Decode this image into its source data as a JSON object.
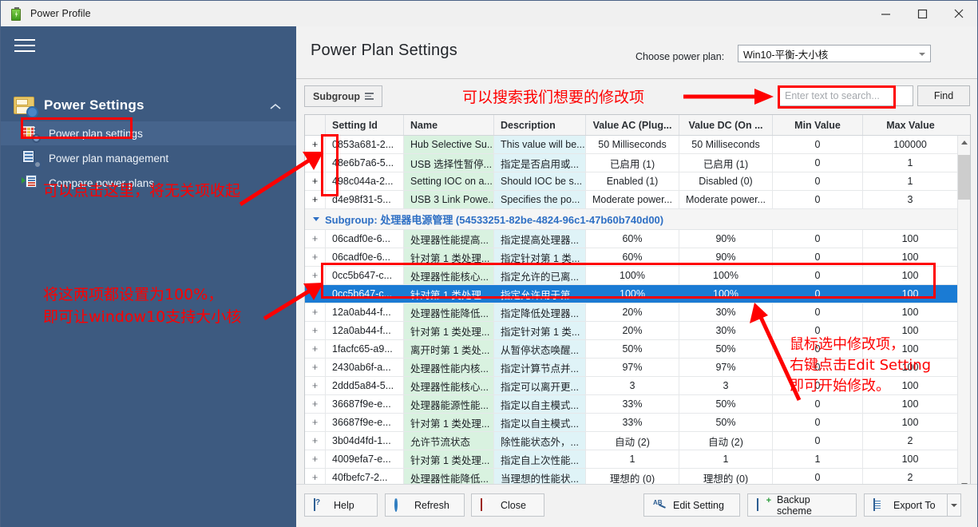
{
  "window": {
    "title": "Power Profile",
    "icon": "battery-icon",
    "minimize": "minimize-icon",
    "maximize": "maximize-icon",
    "close": "close-icon"
  },
  "sidebar": {
    "menu_icon": "hamburger-icon",
    "group": {
      "label": "Power Settings",
      "icon": "power-settings-icon",
      "chevron": "chevron-up-icon"
    },
    "items": [
      {
        "label": "Power plan settings",
        "icon": "power-plan-settings-icon",
        "active": true
      },
      {
        "label": "Power plan management",
        "icon": "power-plan-management-icon",
        "active": false
      },
      {
        "label": "Compare power plans",
        "icon": "compare-power-plans-icon",
        "active": false
      }
    ]
  },
  "header": {
    "title": "Power Plan Settings",
    "choose_label": "Choose power plan:",
    "plan_selected": "Win10-平衡-大小核"
  },
  "toolbar": {
    "subgroup_label": "Subgroup",
    "search_placeholder": "Enter text to search...",
    "search_value": "",
    "find_label": "Find"
  },
  "grid": {
    "columns": [
      "Setting Id",
      "Name",
      "Description",
      "Value AC (Plug...",
      "Value DC (On ...",
      "Min Value",
      "Max Value"
    ],
    "subgroup_header": "Subgroup: 处理器电源管理 (54533251-82be-4824-96c1-47b60b740d00)",
    "rows_top": [
      {
        "expand": "+",
        "id": "0853a681-2...",
        "name": "Hub Selective Su...",
        "desc": "This value will be...",
        "ac": "50 Milliseconds",
        "dc": "50 Milliseconds",
        "min": "0",
        "max": "100000",
        "selected": false
      },
      {
        "expand": "+",
        "id": "48e6b7a6-5...",
        "name": "USB 选择性暂停...",
        "desc": "指定是否启用或...",
        "ac": "已启用 (1)",
        "dc": "已启用 (1)",
        "min": "0",
        "max": "1",
        "selected": false
      },
      {
        "expand": "+",
        "id": "498c044a-2...",
        "name": "Setting IOC on a...",
        "desc": "Should IOC be s...",
        "ac": "Enabled (1)",
        "dc": "Disabled (0)",
        "min": "0",
        "max": "1",
        "selected": false
      },
      {
        "expand": "+",
        "id": "d4e98f31-5...",
        "name": "USB 3 Link Powe...",
        "desc": "Specifies the po...",
        "ac": "Moderate power...",
        "dc": "Moderate power...",
        "min": "0",
        "max": "3",
        "selected": false
      }
    ],
    "rows_bottom": [
      {
        "expand": "+",
        "id": "06cadf0e-6...",
        "name": "处理器性能提高...",
        "desc": "指定提高处理器...",
        "ac": "60%",
        "dc": "90%",
        "min": "0",
        "max": "100",
        "selected": false
      },
      {
        "expand": "+",
        "id": "06cadf0e-6...",
        "name": "针对第 1 类处理...",
        "desc": "指定针对第 1 类...",
        "ac": "60%",
        "dc": "90%",
        "min": "0",
        "max": "100",
        "selected": false
      },
      {
        "expand": "+",
        "id": "0cc5b647-c...",
        "name": "处理器性能核心...",
        "desc": "指定允许的已离...",
        "ac": "100%",
        "dc": "100%",
        "min": "0",
        "max": "100",
        "selected": false
      },
      {
        "expand": "+",
        "id": "0cc5b647-c...",
        "name": "针对第 1 类处理...",
        "desc": "指定允许用于第 ...",
        "ac": "100%",
        "dc": "100%",
        "min": "0",
        "max": "100",
        "selected": true
      },
      {
        "expand": "+",
        "id": "12a0ab44-f...",
        "name": "处理器性能降低...",
        "desc": "指定降低处理器...",
        "ac": "20%",
        "dc": "30%",
        "min": "0",
        "max": "100",
        "selected": false
      },
      {
        "expand": "+",
        "id": "12a0ab44-f...",
        "name": "针对第 1 类处理...",
        "desc": "指定针对第 1 类...",
        "ac": "20%",
        "dc": "30%",
        "min": "0",
        "max": "100",
        "selected": false
      },
      {
        "expand": "+",
        "id": "1facfc65-a9...",
        "name": "离开时第 1 类处...",
        "desc": "从暂停状态唤醒...",
        "ac": "50%",
        "dc": "50%",
        "min": "0",
        "max": "100",
        "selected": false
      },
      {
        "expand": "+",
        "id": "2430ab6f-a...",
        "name": "处理器性能内核...",
        "desc": "指定计算节点并...",
        "ac": "97%",
        "dc": "97%",
        "min": "0",
        "max": "100",
        "selected": false
      },
      {
        "expand": "+",
        "id": "2ddd5a84-5...",
        "name": "处理器性能核心...",
        "desc": "指定可以离开更...",
        "ac": "3",
        "dc": "3",
        "min": "0",
        "max": "100",
        "selected": false
      },
      {
        "expand": "+",
        "id": "36687f9e-e...",
        "name": "处理器能源性能...",
        "desc": "指定以自主模式...",
        "ac": "33%",
        "dc": "50%",
        "min": "0",
        "max": "100",
        "selected": false
      },
      {
        "expand": "+",
        "id": "36687f9e-e...",
        "name": "针对第 1 类处理...",
        "desc": "指定以自主模式...",
        "ac": "33%",
        "dc": "50%",
        "min": "0",
        "max": "100",
        "selected": false
      },
      {
        "expand": "+",
        "id": "3b04d4fd-1...",
        "name": "允许节流状态",
        "desc": "除性能状态外，...",
        "ac": "自动 (2)",
        "dc": "自动 (2)",
        "min": "0",
        "max": "2",
        "selected": false
      },
      {
        "expand": "+",
        "id": "4009efa7-e...",
        "name": "针对第 1 类处理...",
        "desc": "指定自上次性能...",
        "ac": "1",
        "dc": "1",
        "min": "1",
        "max": "100",
        "selected": false
      },
      {
        "expand": "+",
        "id": "40fbefc7-2...",
        "name": "处理器性能降低...",
        "desc": "当理想的性能状...",
        "ac": "理想的 (0)",
        "dc": "理想的 (0)",
        "min": "0",
        "max": "2",
        "selected": false
      }
    ]
  },
  "bottom_buttons": [
    {
      "label": "Help",
      "icon": "help-icon"
    },
    {
      "label": "Refresh",
      "icon": "refresh-icon"
    },
    {
      "label": "Close",
      "icon": "close-x-icon"
    },
    {
      "label": "Edit Setting",
      "icon": "edit-setting-icon"
    },
    {
      "label": "Backup scheme",
      "icon": "backup-scheme-icon"
    },
    {
      "label": "Export To",
      "icon": "export-to-icon"
    }
  ],
  "annotations": {
    "search_hint": "可以搜索我们想要的修改项",
    "collapse_hint": "可以点击这里，将无关项收起",
    "set_100_hint": "将这两项都设置为100%，\n即可让window10支持大小核",
    "edit_hint": "鼠标选中修改项，\n右键点击Edit Setting\n即可开始修改。"
  },
  "colors": {
    "sidebar": "#3d5a80",
    "accent_red": "#fe0000",
    "selection_blue": "#1a7bd4",
    "name_cell": "#d9f2e0",
    "desc_cell": "#dff3f7"
  }
}
